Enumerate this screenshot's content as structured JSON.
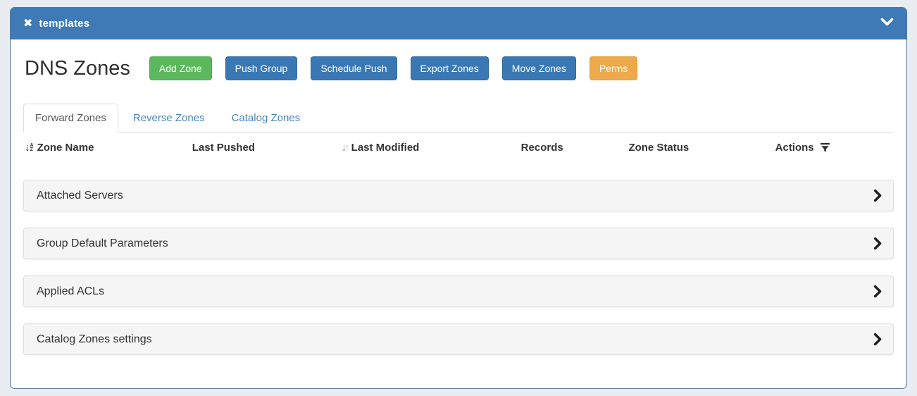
{
  "panel": {
    "title": "templates"
  },
  "icons": {
    "close": "✖",
    "sort_alpha": {
      "arrow": "↓",
      "top": "A",
      "bottom": "Z"
    },
    "sort_down": "↓",
    "sort_up": "↑"
  },
  "header": {
    "title": "DNS Zones",
    "buttons": [
      {
        "label": "Add Zone"
      },
      {
        "label": "Push Group"
      },
      {
        "label": "Schedule Push"
      },
      {
        "label": "Export Zones"
      },
      {
        "label": "Move Zones"
      },
      {
        "label": "Perms"
      }
    ]
  },
  "tabs": [
    {
      "label": "Forward Zones",
      "active": true
    },
    {
      "label": "Reverse Zones",
      "active": false
    },
    {
      "label": "Catalog Zones",
      "active": false
    }
  ],
  "table": {
    "columns": [
      {
        "label": "Zone Name",
        "sort_icon": "sort-alpha-down"
      },
      {
        "label": "Last Pushed"
      },
      {
        "label": "Last Modified",
        "sort_icon": "sort-up-down"
      },
      {
        "label": "Records"
      },
      {
        "label": "Zone Status"
      },
      {
        "label": "Actions",
        "filter_icon": true
      }
    ],
    "rows": []
  },
  "accordions": [
    {
      "label": "Attached Servers"
    },
    {
      "label": "Group Default Parameters"
    },
    {
      "label": "Applied ACLs"
    },
    {
      "label": "Catalog Zones settings"
    }
  ],
  "colors": {
    "panel_header_bg": "#3d7ab6",
    "button_green": "#5cb85c",
    "button_blue": "#3a78b5",
    "button_orange": "#edaa4a",
    "tab_link": "#4d85b5",
    "accordion_bg": "#f5f5f5",
    "page_bg": "#e9edf2",
    "card_border": "#53769b"
  }
}
